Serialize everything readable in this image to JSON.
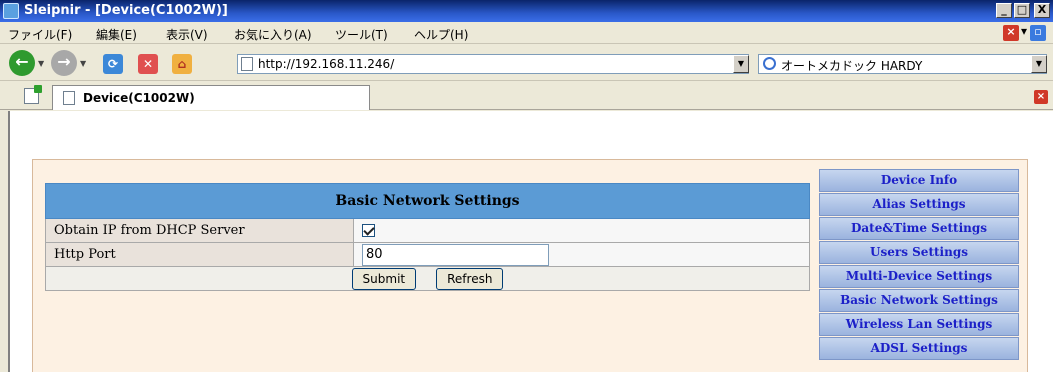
{
  "window": {
    "title": "Sleipnir - [Device(C1002W)]",
    "controls": [
      "_",
      "□",
      "X"
    ]
  },
  "menu": {
    "items": [
      "ファイル(F)",
      "編集(E)",
      "表示(V)",
      "お気に入り(A)",
      "ツール(T)",
      "ヘルプ(H)"
    ]
  },
  "toolbar": {
    "url": "http://192.168.11.246/",
    "search_engine": "オートメカドック HARDY"
  },
  "tab": {
    "title": "Device(C1002W)"
  },
  "settings": {
    "header": "Basic Network Settings",
    "rows": [
      {
        "label": "Obtain IP from DHCP Server",
        "checked": true
      },
      {
        "label": "Http Port",
        "value": "80"
      }
    ],
    "submit_label": "Submit",
    "refresh_label": "Refresh"
  },
  "sidenav": {
    "items": [
      "Device Info",
      "Alias Settings",
      "Date&Time Settings",
      "Users Settings",
      "Multi-Device Settings",
      "Basic Network Settings",
      "Wireless Lan Settings",
      "ADSL Settings"
    ]
  }
}
